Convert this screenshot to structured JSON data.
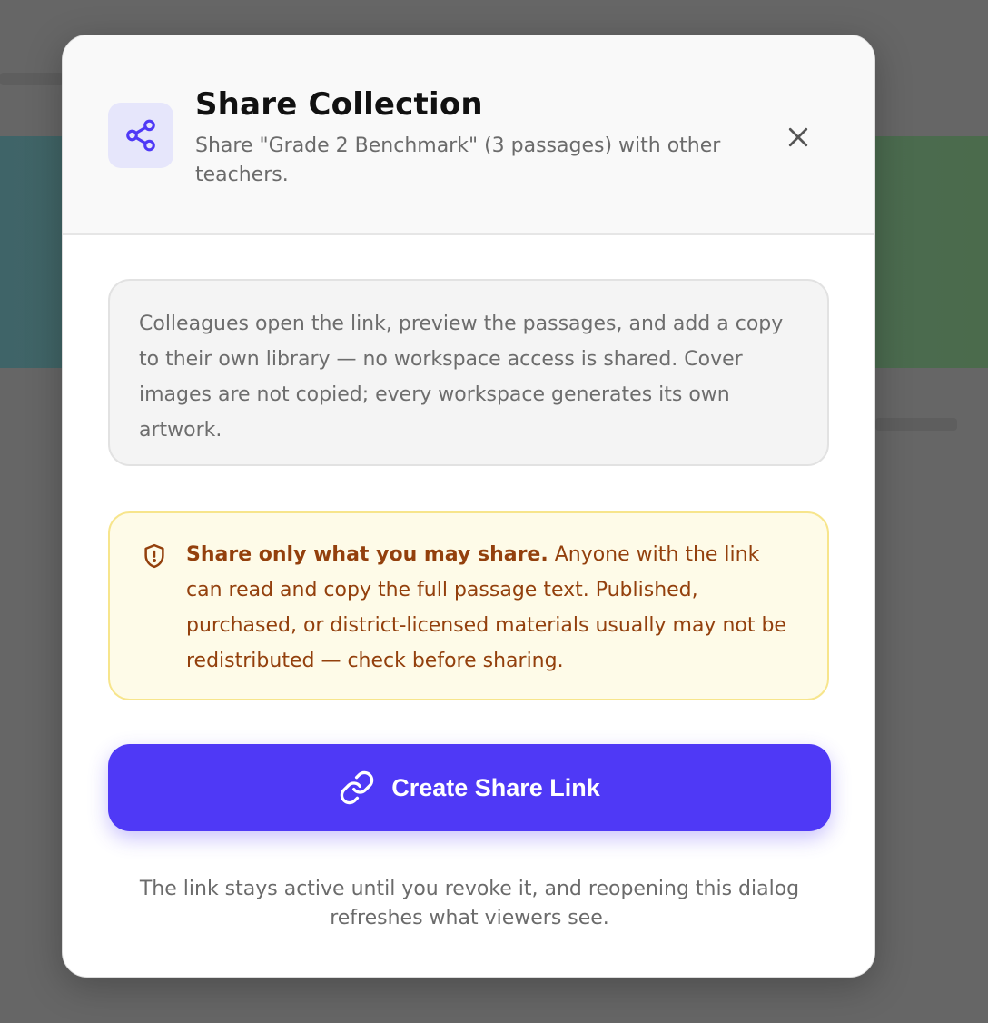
{
  "dialog": {
    "title": "Share Collection",
    "subtitle": "Share \"Grade 2 Benchmark\" (3 passages) with other teachers.",
    "header_icon": "share-icon",
    "close_icon": "close-icon"
  },
  "info": {
    "text": "Colleagues open the link, preview the passages, and add a copy to their own library — no workspace access is shared. Cover images are not copied; every workspace generates its own artwork."
  },
  "warning": {
    "icon": "shield-alert-icon",
    "bold": "Share only what you may share.",
    "text": " Anyone with the link can read and copy the full passage text. Published, purchased, or district-licensed materials usually may not be redistributed — check before sharing."
  },
  "action": {
    "label": "Create Share Link",
    "icon": "link-icon"
  },
  "footnote": "The link stays active until you revoke it, and reopening this dialog refreshes what viewers see.",
  "colors": {
    "accent": "#4f39f6",
    "warning_text": "#93400d",
    "warning_bg": "#fefbe8",
    "warning_border": "#f7e58c",
    "icon_tile": "#e6e6fb"
  }
}
